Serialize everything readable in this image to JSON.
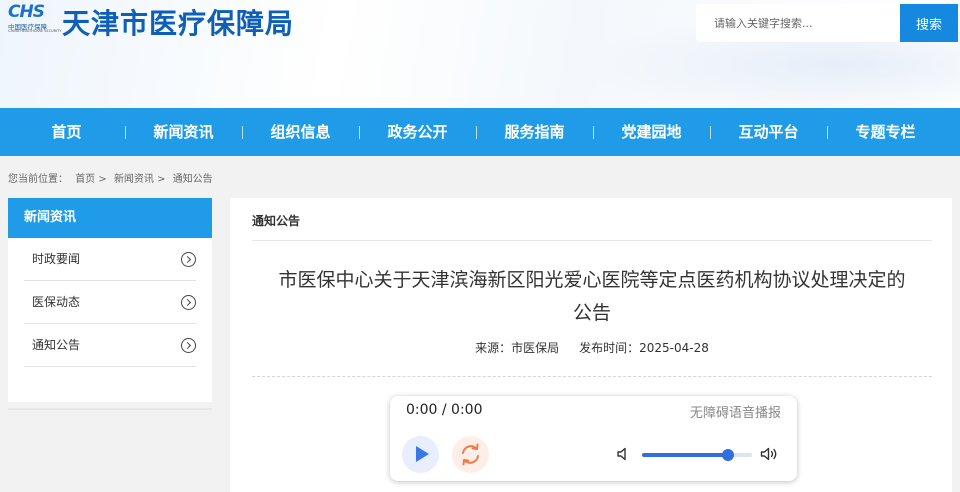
{
  "header": {
    "logo_mark": "CHS",
    "logo_cn": "中国医疗保障",
    "logo_en": "CHINA HEALTHCARE SECURITY",
    "site_title": "天津市医疗保障局",
    "search": {
      "placeholder": "请输入关键字搜索...",
      "button_label": "搜索"
    }
  },
  "nav": {
    "items": [
      {
        "label": "首页"
      },
      {
        "label": "新闻资讯"
      },
      {
        "label": "组织信息"
      },
      {
        "label": "政务公开"
      },
      {
        "label": "服务指南"
      },
      {
        "label": "党建园地"
      },
      {
        "label": "互动平台"
      },
      {
        "label": "专题专栏"
      }
    ]
  },
  "breadcrumb": {
    "prefix": "您当前位置：",
    "items": [
      "首页 >",
      "新闻资讯 >",
      "通知公告"
    ]
  },
  "sidebar": {
    "title": "新闻资讯",
    "items": [
      {
        "label": "时政要闻",
        "icon": "chevron-right-circle-icon"
      },
      {
        "label": "医保动态",
        "icon": "chevron-right-circle-icon"
      },
      {
        "label": "通知公告",
        "icon": "chevron-right-circle-icon"
      }
    ]
  },
  "content": {
    "section_heading": "通知公告",
    "article": {
      "title_line1": "市医保中心关于天津滨海新区阳光爱心医院等定点医药机构协议处理决定的",
      "title_line2": "公告",
      "source_label": "来源：市医保局",
      "publish_label": "发布时间：2025-04-28"
    }
  },
  "player": {
    "time_display": "0:00 / 0:00",
    "label": "无障碍语音播报",
    "volume_level": 0.78,
    "icons": {
      "play": "play-icon",
      "loop": "loop-icon",
      "volume_low": "volume-low-icon",
      "volume_high": "volume-high-icon"
    },
    "colors": {
      "accent": "#2f6fe0",
      "loop": "#f07a4a"
    }
  },
  "theme": {
    "primary": "#1f9be8",
    "title_blue": "#0e5fb8"
  }
}
